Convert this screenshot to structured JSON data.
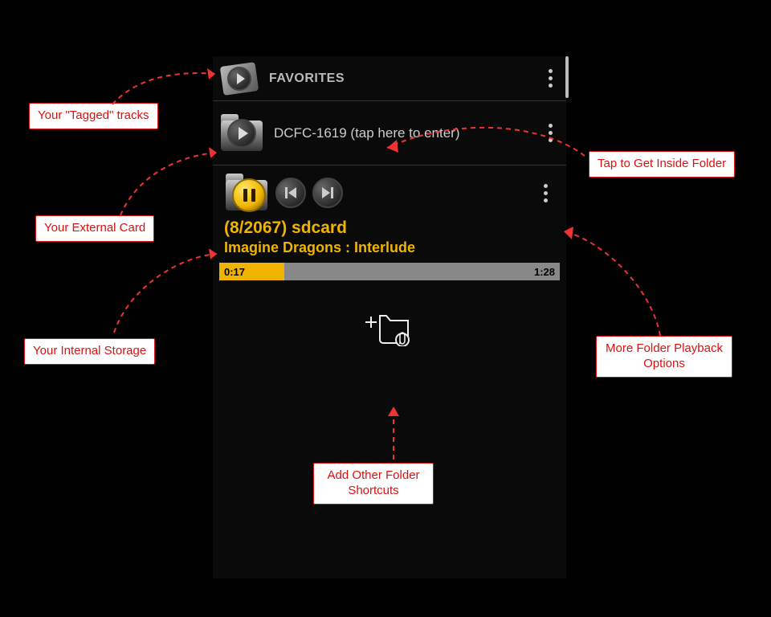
{
  "favorites": {
    "label": "FAVORITES"
  },
  "folder": {
    "label": "DCFC-1619 (tap here to enter)"
  },
  "player": {
    "counter": "(8/2067)  sdcard",
    "track": "Imagine Dragons : Interlude",
    "elapsed": "0:17",
    "duration": "1:28"
  },
  "callouts": {
    "tagged": "Your \"Tagged\" tracks",
    "external": "Your External Card",
    "internal": "Your Internal Storage",
    "inside": "Tap to Get Inside Folder",
    "more": "More Folder Playback Options",
    "add": "Add Other Folder Shortcuts"
  }
}
